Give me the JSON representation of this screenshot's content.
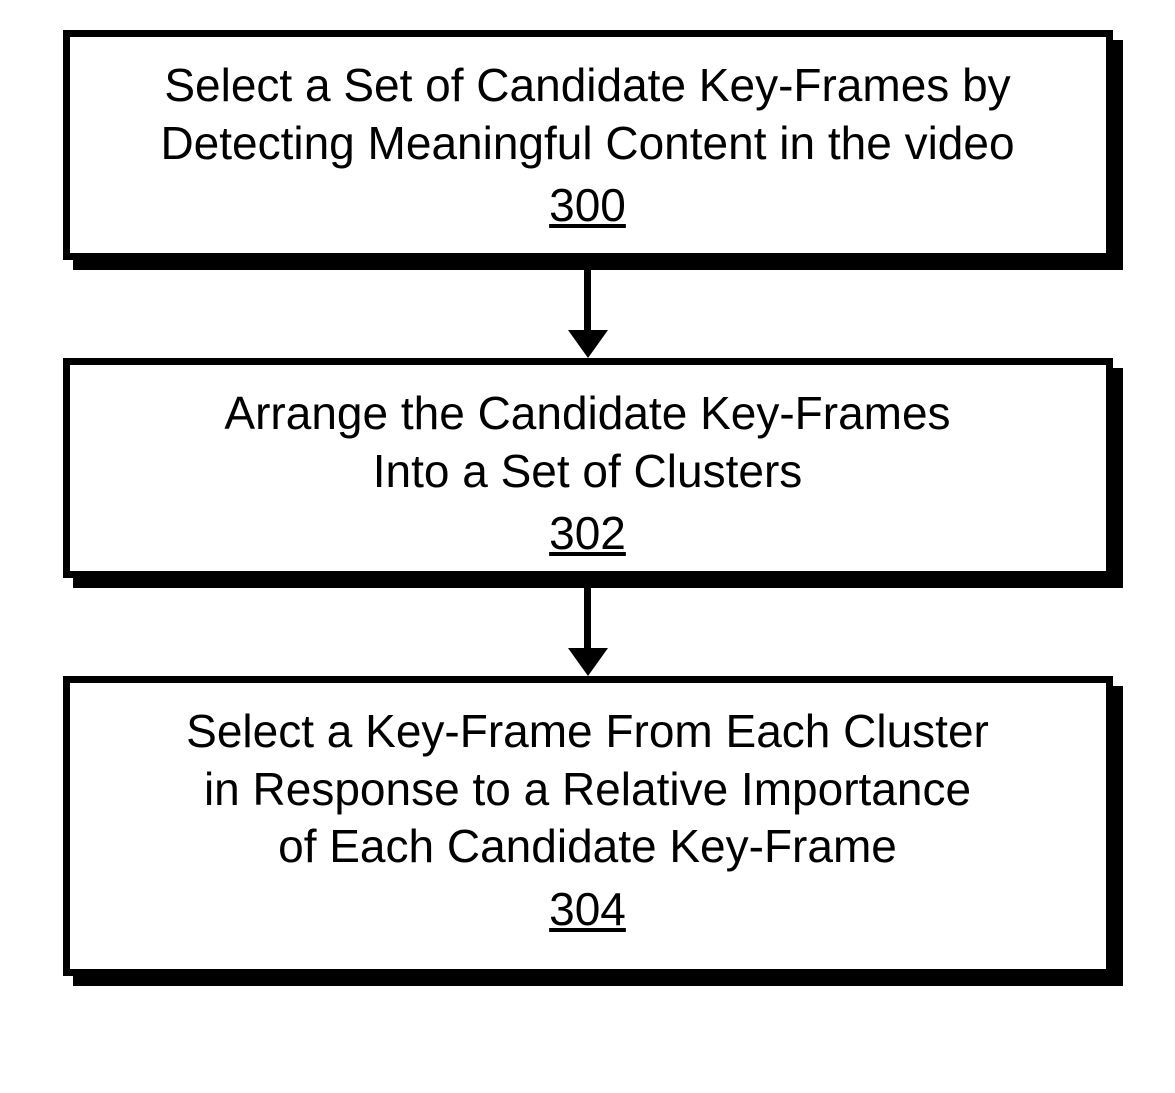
{
  "flowchart": {
    "steps": [
      {
        "line1": "Select a Set of Candidate Key-Frames by",
        "line2": "Detecting Meaningful Content in the video",
        "ref": "300"
      },
      {
        "line1": "Arrange the Candidate Key-Frames",
        "line2": "Into a Set of Clusters",
        "ref": "302"
      },
      {
        "line1": "Select a Key-Frame From Each Cluster",
        "line2": "in Response to a Relative Importance",
        "line3": "of Each Candidate Key-Frame",
        "ref": "304"
      }
    ]
  }
}
